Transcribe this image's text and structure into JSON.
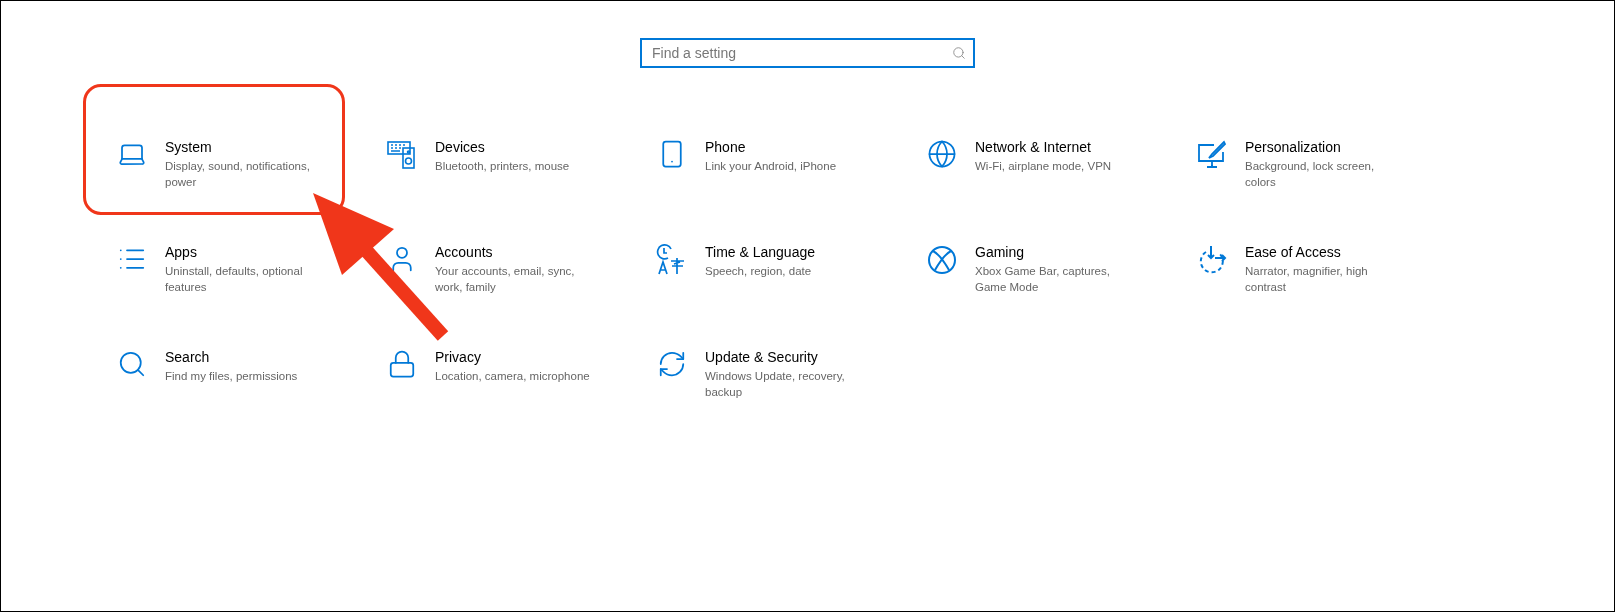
{
  "search": {
    "placeholder": "Find a setting"
  },
  "tiles": [
    {
      "title": "System",
      "description": "Display, sound, notifications, power",
      "highlighted": true
    },
    {
      "title": "Devices",
      "description": "Bluetooth, printers, mouse",
      "highlighted": false
    },
    {
      "title": "Phone",
      "description": "Link your Android, iPhone",
      "highlighted": false
    },
    {
      "title": "Network & Internet",
      "description": "Wi-Fi, airplane mode, VPN",
      "highlighted": false
    },
    {
      "title": "Personalization",
      "description": "Background, lock screen, colors",
      "highlighted": false
    },
    {
      "title": "Apps",
      "description": "Uninstall, defaults, optional features",
      "highlighted": false
    },
    {
      "title": "Accounts",
      "description": "Your accounts, email, sync, work, family",
      "highlighted": false
    },
    {
      "title": "Time & Language",
      "description": "Speech, region, date",
      "highlighted": false
    },
    {
      "title": "Gaming",
      "description": "Xbox Game Bar, captures, Game Mode",
      "highlighted": false
    },
    {
      "title": "Ease of Access",
      "description": "Narrator, magnifier, high contrast",
      "highlighted": false
    },
    {
      "title": "Search",
      "description": "Find my files, permissions",
      "highlighted": false
    },
    {
      "title": "Privacy",
      "description": "Location, camera, microphone",
      "highlighted": false
    },
    {
      "title": "Update & Security",
      "description": "Windows Update, recovery, backup",
      "highlighted": false
    }
  ]
}
